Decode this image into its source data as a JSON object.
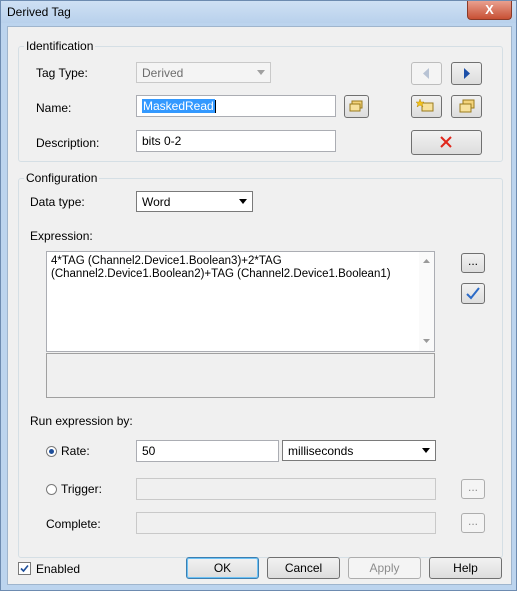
{
  "window": {
    "title": "Derived Tag",
    "close_glyph": "X"
  },
  "identification": {
    "group_title": "Identification",
    "tag_type_label": "Tag Type:",
    "tag_type_value": "Derived",
    "name_label": "Name:",
    "name_value": "MaskedRead",
    "description_label": "Description:",
    "description_value": "bits 0-2"
  },
  "configuration": {
    "group_title": "Configuration",
    "data_type_label": "Data type:",
    "data_type_value": "Word",
    "expression_label": "Expression:",
    "expression_text": "4*TAG (Channel2.Device1.Boolean3)+2*TAG\n(Channel2.Device1.Boolean2)+TAG (Channel2.Device1.Boolean1)",
    "ellipsis_label": "...",
    "run_by_label": "Run expression by:",
    "rate_label": "Rate:",
    "rate_value": "50",
    "rate_unit": "milliseconds",
    "rate_selected": true,
    "trigger_label": "Trigger:",
    "trigger_value": "",
    "complete_label": "Complete:",
    "complete_value": ""
  },
  "footer": {
    "enabled_label": "Enabled",
    "enabled_checked": true,
    "ok_label": "OK",
    "cancel_label": "Cancel",
    "apply_label": "Apply",
    "help_label": "Help"
  },
  "colors": {
    "delete_x": "#e0271c",
    "nav_arrow": "#1c4fa8",
    "check": "#2c6bc7",
    "selection": "#3399ff"
  }
}
